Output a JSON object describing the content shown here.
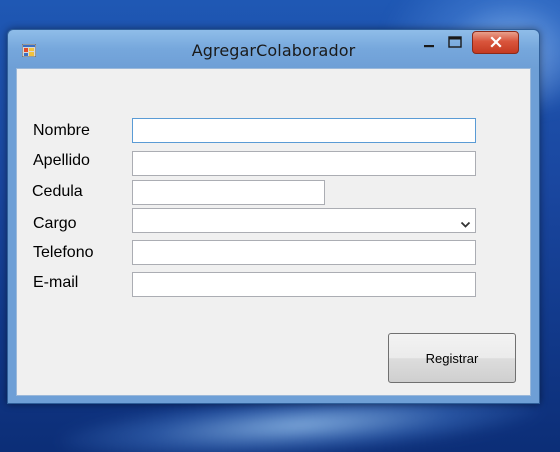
{
  "window": {
    "title": "AgregarColaborador"
  },
  "form": {
    "fields": [
      {
        "label": "Nombre",
        "value": ""
      },
      {
        "label": "Apellido",
        "value": ""
      },
      {
        "label": "Cedula",
        "value": ""
      },
      {
        "label": "Cargo",
        "value": ""
      },
      {
        "label": "Telefono",
        "value": ""
      },
      {
        "label": "E-mail",
        "value": ""
      }
    ],
    "submit_label": "Registrar"
  },
  "colors": {
    "close_button": "#c53a21",
    "focus_border": "#5a9bd5",
    "client_background": "#f0f0f0"
  },
  "icons": {
    "app": "app-icon",
    "minimize": "minimize-icon",
    "maximize": "maximize-icon",
    "close": "close-icon",
    "dropdown": "chevron-down-icon"
  }
}
